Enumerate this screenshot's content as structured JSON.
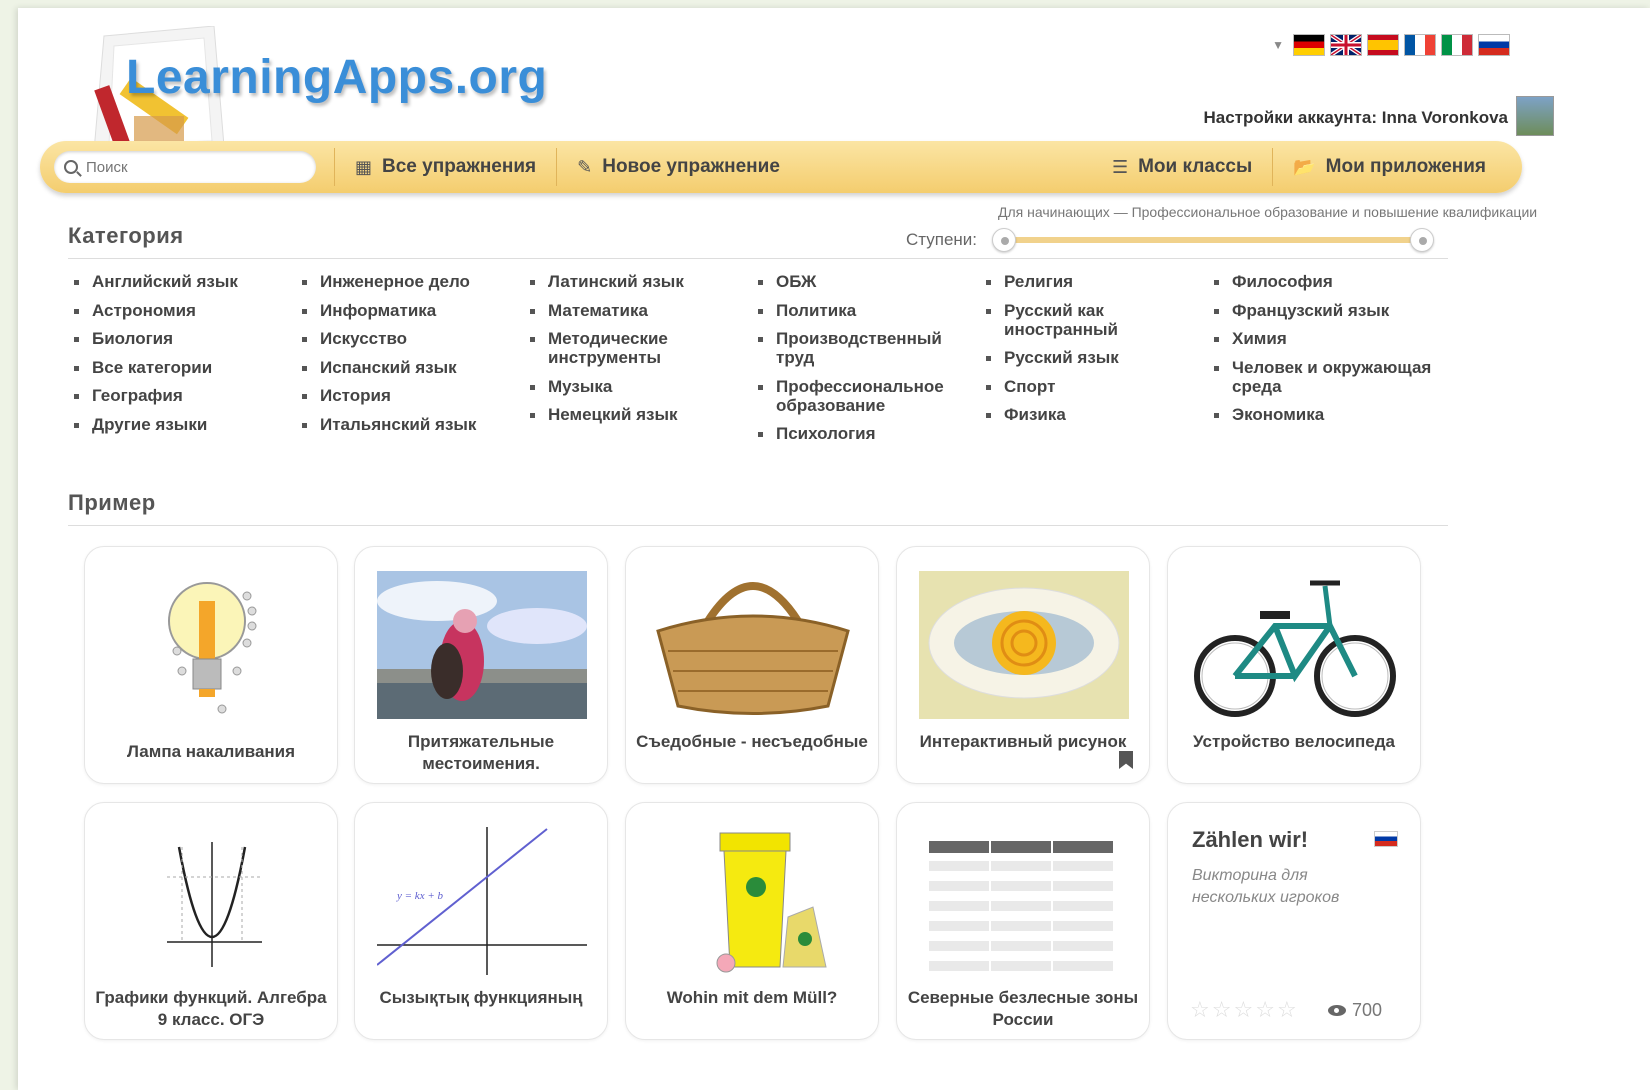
{
  "header": {
    "logo": "LearningApps.org",
    "account_label": "Настройки аккаунта: Inna Voronkova",
    "languages": [
      {
        "name": "german-flag-icon",
        "colors": [
          "#000000",
          "#dd0000",
          "#ffce00"
        ]
      },
      {
        "name": "uk-flag-icon",
        "colors": [
          "#012169",
          "#ffffff",
          "#c8102e"
        ]
      },
      {
        "name": "spanish-flag-icon",
        "colors": [
          "#c60b1e",
          "#ffc400",
          "#c60b1e"
        ]
      },
      {
        "name": "french-flag-icon",
        "colors": [
          "#0055a4",
          "#ffffff",
          "#ef4135"
        ]
      },
      {
        "name": "italian-flag-icon",
        "colors": [
          "#009246",
          "#ffffff",
          "#ce2b37"
        ]
      },
      {
        "name": "russian-flag-icon",
        "colors": [
          "#ffffff",
          "#0039a6",
          "#d52b1e"
        ]
      }
    ]
  },
  "nav": {
    "search_placeholder": "Поиск",
    "all_exercises": "Все упражнения",
    "new_exercise": "Новое упражнение",
    "my_classes": "Мои классы",
    "my_apps": "Мои приложения"
  },
  "category": {
    "title": "Категория",
    "stage_label": "Ступени:",
    "stage_range": "Для начинающих — Профессиональное образование и повышение квалификации",
    "stage_min": 0,
    "stage_max": 1,
    "columns": [
      [
        "Английский язык",
        "Астрономия",
        "Биология",
        "Все категории",
        "География",
        "Другие языки"
      ],
      [
        "Инженерное дело",
        "Информатика",
        "Искусство",
        "Испанский язык",
        "История",
        "Итальянский язык"
      ],
      [
        "Латинский язык",
        "Математика",
        "Методические инструменты",
        "Музыка",
        "Немецкий язык"
      ],
      [
        "ОБЖ",
        "Политика",
        "Производственный труд",
        "Профессиональное образование",
        "Психология"
      ],
      [
        "Религия",
        "Русский как иностранный",
        "Русский язык",
        "Спорт",
        "Физика"
      ],
      [
        "Философия",
        "Французский язык",
        "Химия",
        "Человек и окружающая среда",
        "Экономика"
      ]
    ]
  },
  "examples": {
    "title": "Пример",
    "cards": [
      {
        "title": "Лампа накаливания",
        "image": "lightbulb"
      },
      {
        "title": "Притяжательные местоимения.",
        "image": "photo-child"
      },
      {
        "title": "Съедобные - несъедобные",
        "image": "basket"
      },
      {
        "title": "Интерактивный рисунок",
        "image": "eye-diagram",
        "bookmarked": true
      },
      {
        "title": "Устройство велосипеда",
        "image": "bicycle"
      },
      {
        "title": "Графики функций. Алгебра 9 класс. ОГЭ",
        "image": "parabola-graph"
      },
      {
        "title": "Сызықтық функцияның",
        "image": "linear-graph",
        "graph_label": "y = kx + b"
      },
      {
        "title": "Wohin mit dem Müll?",
        "image": "trash-bin"
      },
      {
        "title": "Северные безлесные зоны России",
        "image": "table"
      }
    ],
    "quiz_card": {
      "title": "Zählen wir!",
      "subtitle": "Викторина для нескольких игроков",
      "rating": 0,
      "rating_max": 5,
      "views": "700"
    }
  }
}
